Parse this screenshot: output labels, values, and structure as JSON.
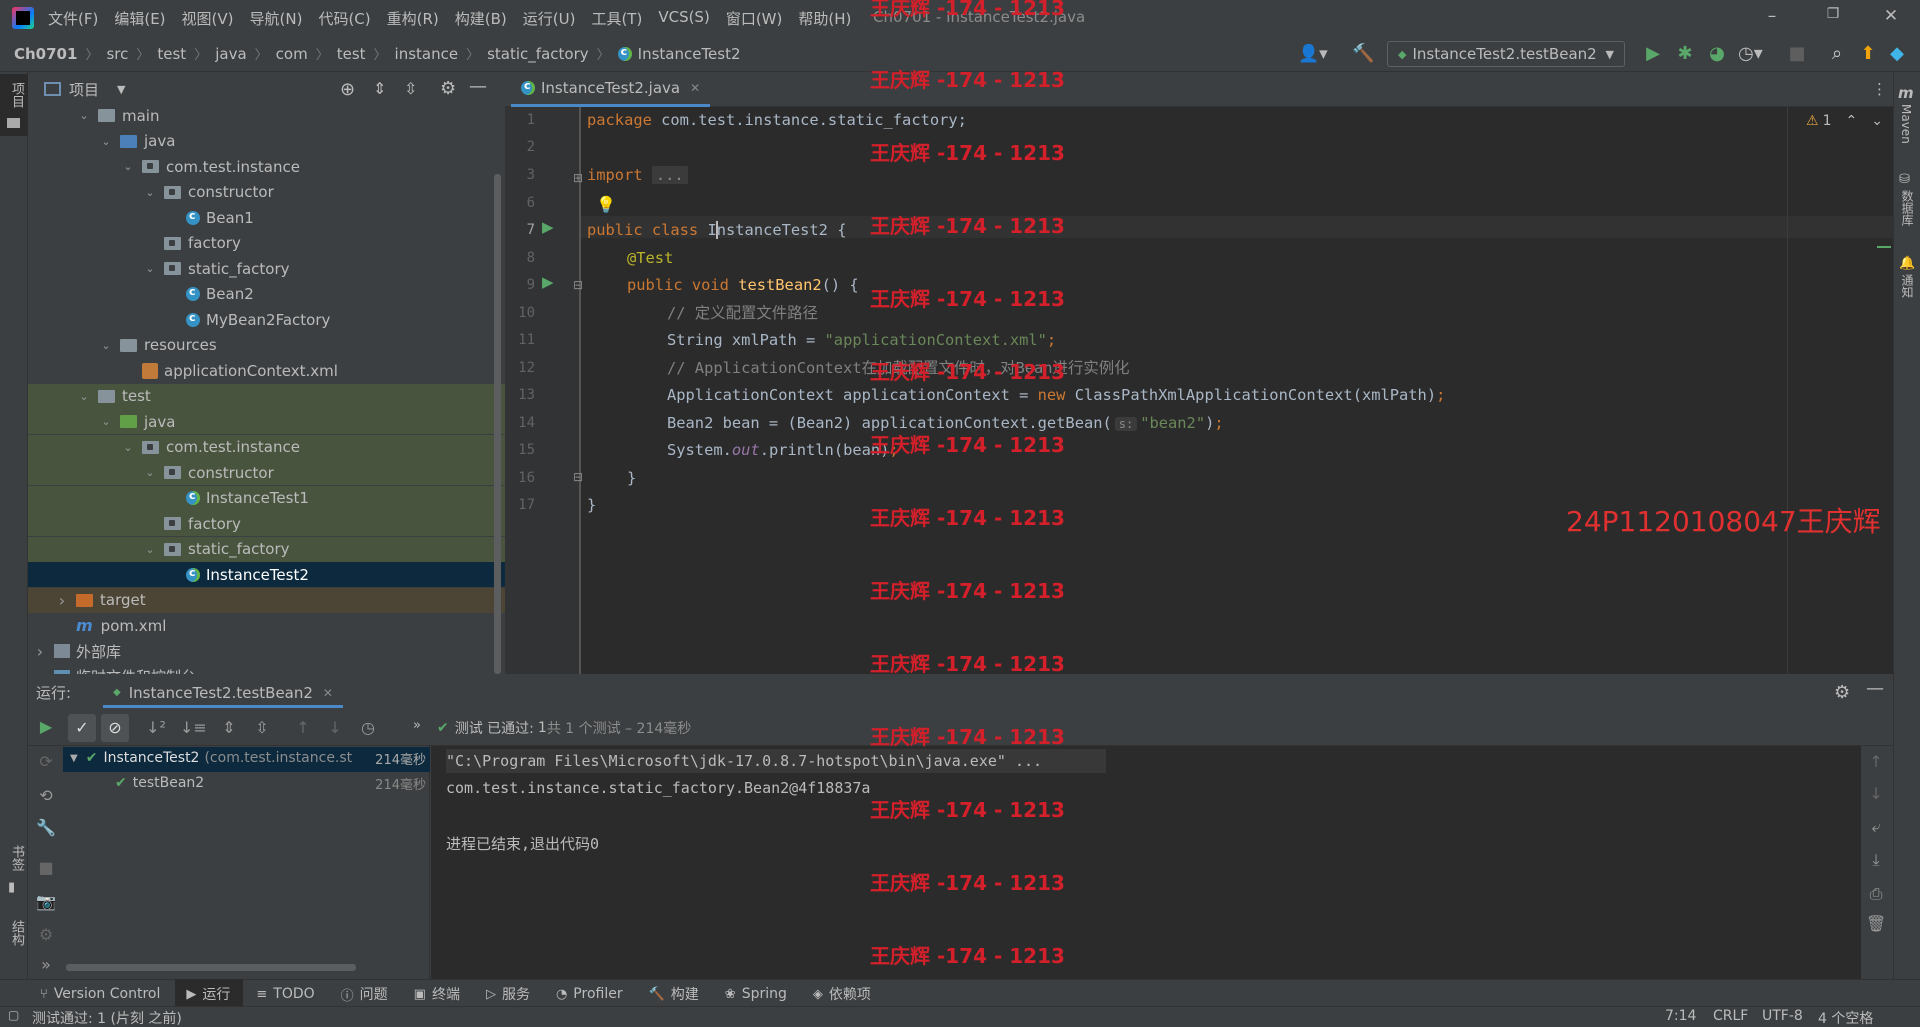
{
  "menu": [
    "文件(F)",
    "编辑(E)",
    "视图(V)",
    "导航(N)",
    "代码(C)",
    "重构(R)",
    "构建(B)",
    "运行(U)",
    "工具(T)",
    "VCS(S)",
    "窗口(W)",
    "帮助(H)"
  ],
  "window_title": "Ch0701 - InstanceTest2.java",
  "breadcrumbs": [
    "Ch0701",
    "src",
    "test",
    "java",
    "com",
    "test",
    "instance",
    "static_factory",
    "InstanceTest2"
  ],
  "run_config": "InstanceTest2.testBean2",
  "left_stripe": {
    "project": "项目",
    "bookmarks": "书签",
    "structure": "结构"
  },
  "right_stripe": {
    "maven": "Maven",
    "database": "数据库",
    "notifications": "通知"
  },
  "project_panel": {
    "title": "项目",
    "tree": [
      {
        "label": "main",
        "indent": 2,
        "icon": "folder",
        "expanded": true
      },
      {
        "label": "java",
        "indent": 3,
        "icon": "folder-blue",
        "expanded": true
      },
      {
        "label": "com.test.instance",
        "indent": 4,
        "icon": "package",
        "expanded": true
      },
      {
        "label": "constructor",
        "indent": 5,
        "icon": "package",
        "expanded": true
      },
      {
        "label": "Bean1",
        "indent": 6,
        "icon": "class"
      },
      {
        "label": "factory",
        "indent": 5,
        "icon": "package"
      },
      {
        "label": "static_factory",
        "indent": 5,
        "icon": "package",
        "expanded": true
      },
      {
        "label": "Bean2",
        "indent": 6,
        "icon": "class"
      },
      {
        "label": "MyBean2Factory",
        "indent": 6,
        "icon": "class"
      },
      {
        "label": "resources",
        "indent": 3,
        "icon": "folder",
        "expanded": true
      },
      {
        "label": "applicationContext.xml",
        "indent": 4,
        "icon": "xml"
      },
      {
        "label": "test",
        "indent": 2,
        "icon": "folder",
        "expanded": true
      },
      {
        "label": "java",
        "indent": 3,
        "icon": "folder-green",
        "expanded": true
      },
      {
        "label": "com.test.instance",
        "indent": 4,
        "icon": "package",
        "expanded": true
      },
      {
        "label": "constructor",
        "indent": 5,
        "icon": "package",
        "expanded": true
      },
      {
        "label": "InstanceTest1",
        "indent": 6,
        "icon": "test-class"
      },
      {
        "label": "factory",
        "indent": 5,
        "icon": "package"
      },
      {
        "label": "static_factory",
        "indent": 5,
        "icon": "package",
        "expanded": true
      },
      {
        "label": "InstanceTest2",
        "indent": 6,
        "icon": "test-class",
        "selected": true
      },
      {
        "label": "target",
        "indent": 1,
        "icon": "folder-orange",
        "expanded": false
      },
      {
        "label": "pom.xml",
        "indent": 1,
        "icon": "maven"
      },
      {
        "label": "外部库",
        "indent": 0,
        "icon": "library",
        "expanded": false
      },
      {
        "label": "临时文件和控制台",
        "indent": 0,
        "icon": "scratch",
        "expanded": false
      }
    ]
  },
  "editor": {
    "tab": "InstanceTest2.java",
    "warnings": "1",
    "line_numbers": [
      "1",
      "2",
      "3",
      "6",
      "7",
      "8",
      "9",
      "10",
      "11",
      "12",
      "13",
      "14",
      "15",
      "16",
      "17"
    ],
    "lines": {
      "l1_kw": "package",
      "l1_rest": " com.test.instance.static_factory;",
      "l3_kw": "import",
      "l3_fold": "...",
      "l7_kw": "public class",
      "l7_name": "InstanceTest2",
      "l7_rest": " {",
      "l8_ann": "@Test",
      "l9_kw": "public void",
      "l9_fn": "testBean2",
      "l9_rest": "() {",
      "l10_cm": "// 定义配置文件路径",
      "l11_a": "String xmlPath = ",
      "l11_str": "\"applicationContext.xml\"",
      "l11_semi": ";",
      "l12_cm": "// ApplicationContext在加载配置文件时，对Bean进行实例化",
      "l13_a": "ApplicationContext applicationContext = ",
      "l13_kw": "new",
      "l13_b": " ClassPathXmlApplicationContext(xmlPath)",
      "l13_semi": ";",
      "l14_a": "Bean2 bean = (Bean2) applicationContext.getBean(",
      "l14_hint": "s:",
      "l14_str": "\"bean2\"",
      "l14_b": ")",
      "l14_semi": ";",
      "l15_a": "System.",
      "l15_sf": "out",
      "l15_b": ".println(bean)",
      "l15_semi": ";",
      "l16": "}",
      "l17": "}"
    }
  },
  "run_panel": {
    "label": "运行:",
    "tab": "InstanceTest2.testBean2",
    "status_prefix": "测试 已通过:",
    "status_count": "1",
    "status_detail": "共 1 个测试 – 214毫秒",
    "tree": [
      {
        "label": "InstanceTest2",
        "detail": "(com.test.instance.st",
        "time": "214毫秒"
      },
      {
        "label": "testBean2",
        "detail": "",
        "time": "214毫秒"
      }
    ],
    "console": [
      "\"C:\\Program Files\\Microsoft\\jdk-17.0.8.7-hotspot\\bin\\java.exe\" ...",
      "com.test.instance.static_factory.Bean2@4f18837a",
      "",
      "进程已结束,退出代码0"
    ]
  },
  "tool_windows": [
    "Version Control",
    "运行",
    "TODO",
    "问题",
    "终端",
    "服务",
    "Profiler",
    "构建",
    "Spring",
    "依赖项"
  ],
  "status": {
    "message": "测试通过: 1 (片刻 之前)",
    "position": "7:14",
    "line_sep": "CRLF",
    "encoding": "UTF-8",
    "indent": "4 个空格"
  },
  "watermark_red": "王庆辉 -174 - 1213",
  "id_watermark": "24P1120108047王庆辉",
  "colors": {
    "accent": "#4a88c7",
    "selection": "#0d293e",
    "test_bg": "#49543f",
    "excluded_bg": "#4c4536",
    "pass": "#59a869",
    "watermark": "#d3202a"
  }
}
